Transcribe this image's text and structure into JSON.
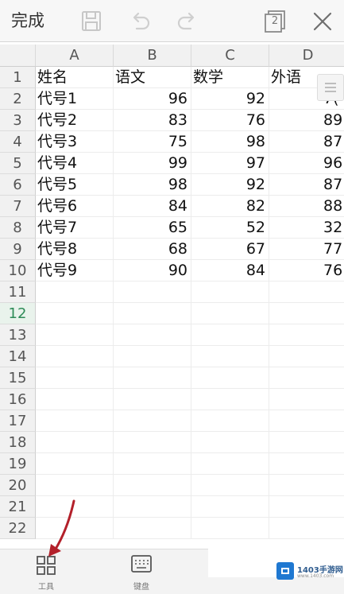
{
  "toolbar": {
    "done_label": "完成",
    "sheet_count": "2"
  },
  "sheet": {
    "columns": [
      "A",
      "B",
      "C",
      "D"
    ],
    "row_numbers": [
      "1",
      "2",
      "3",
      "4",
      "5",
      "6",
      "7",
      "8",
      "9",
      "10",
      "11",
      "12",
      "13",
      "14",
      "15",
      "16",
      "17",
      "18",
      "19",
      "20",
      "21",
      "22"
    ],
    "active_row": "12",
    "header_row": [
      "姓名",
      "语文",
      "数学",
      "外语"
    ],
    "data_rows": [
      [
        "代号1",
        "96",
        "92",
        "7("
      ],
      [
        "代号2",
        "83",
        "76",
        "89"
      ],
      [
        "代号3",
        "75",
        "98",
        "87"
      ],
      [
        "代号4",
        "99",
        "97",
        "96"
      ],
      [
        "代号5",
        "98",
        "92",
        "87"
      ],
      [
        "代号6",
        "84",
        "82",
        "88"
      ],
      [
        "代号7",
        "65",
        "52",
        "32"
      ],
      [
        "代号8",
        "68",
        "67",
        "77"
      ],
      [
        "代号9",
        "90",
        "84",
        "76"
      ]
    ]
  },
  "bottom_bar": {
    "tools_label": "工具",
    "keyboard_label": "键盘"
  },
  "watermark": {
    "brand": "1403手游网",
    "url": "www.1403.com"
  },
  "colors": {
    "active_row_text": "#2e8b57",
    "arrow": "#b3202a",
    "watermark_logo": "#1f78d1"
  }
}
